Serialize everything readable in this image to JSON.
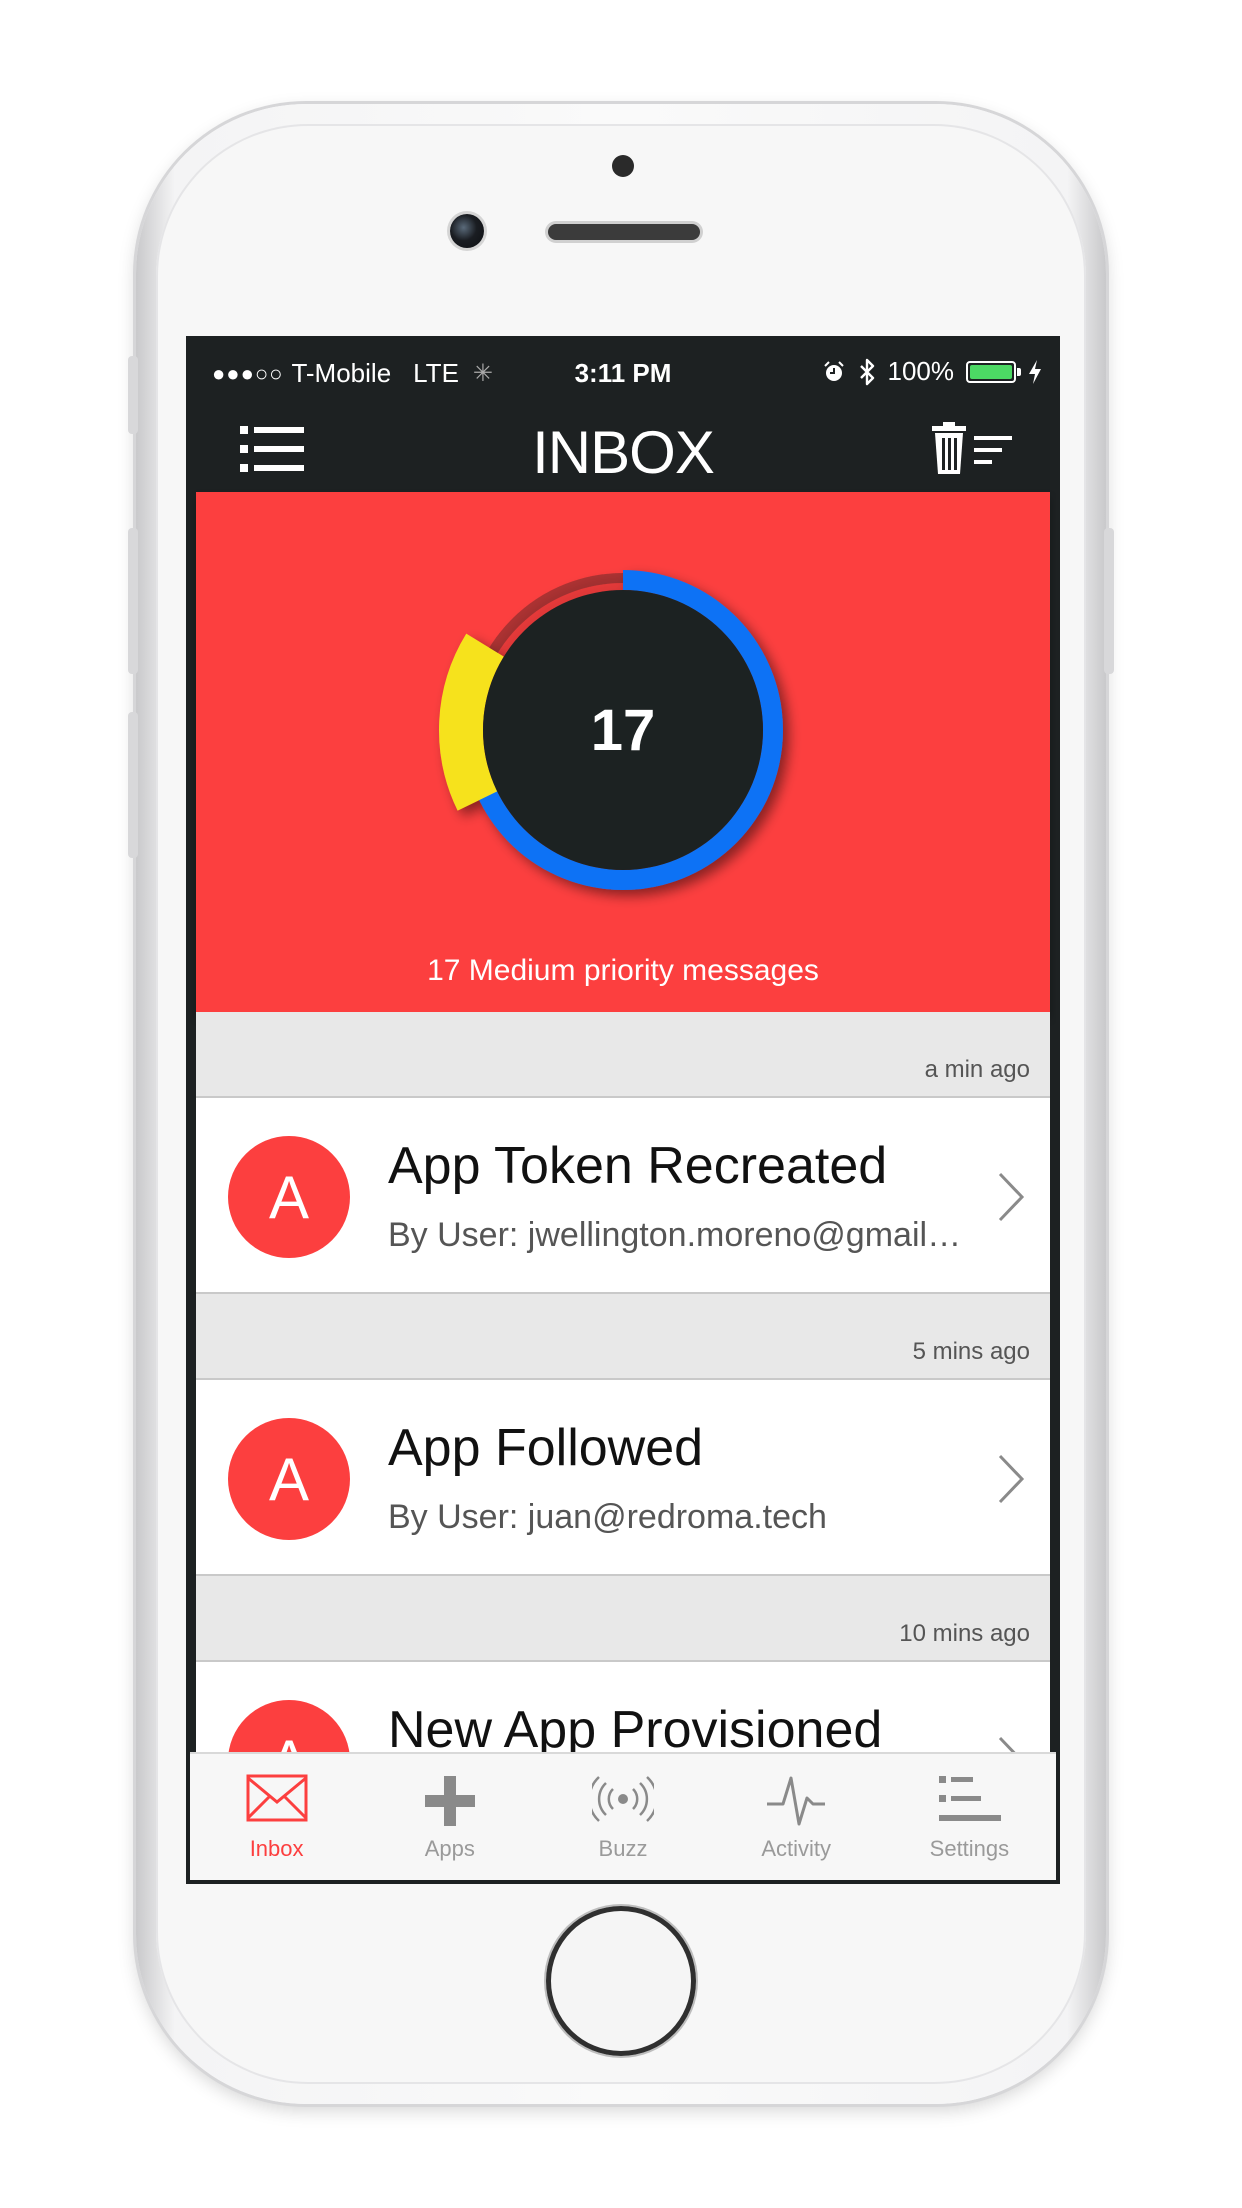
{
  "status_bar": {
    "signal": "●●●○○",
    "carrier": "T-Mobile",
    "network": "LTE",
    "time": "3:11 PM",
    "battery": "100%"
  },
  "navbar": {
    "title": "INBOX"
  },
  "hero": {
    "count": "17",
    "caption": "17 Medium priority messages",
    "ring": {
      "blue_fraction": 0.69,
      "yellow_fraction": 0.16
    },
    "colors": {
      "background": "#fc3f3f",
      "blue": "#1072f5",
      "yellow": "#f6e21c",
      "center": "#1d2122"
    }
  },
  "feed": [
    {
      "time": "a min ago",
      "avatar": "A",
      "title": "App Token Recreated",
      "subtitle": "By User: jwellington.moreno@gmail.com"
    },
    {
      "time": "5 mins ago",
      "avatar": "A",
      "title": "App Followed",
      "subtitle": "By User: juan@redroma.tech"
    },
    {
      "time": "10 mins ago",
      "avatar": "A",
      "title": "New App Provisioned",
      "subtitle": ""
    }
  ],
  "tabs": [
    {
      "label": "Inbox",
      "icon": "envelope-icon",
      "active": true
    },
    {
      "label": "Apps",
      "icon": "plus-icon",
      "active": false
    },
    {
      "label": "Buzz",
      "icon": "broadcast-icon",
      "active": false
    },
    {
      "label": "Activity",
      "icon": "pulse-icon",
      "active": false
    },
    {
      "label": "Settings",
      "icon": "settings-list-icon",
      "active": false
    }
  ]
}
